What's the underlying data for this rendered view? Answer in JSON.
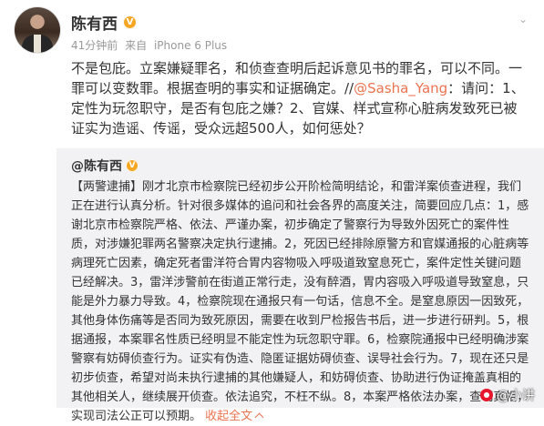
{
  "post": {
    "author": "陈有西",
    "verified_badge": "V",
    "time": "41分钟前",
    "source_prefix": "来自",
    "source": "iPhone 6 Plus",
    "text_part1": "不是包庇。立案嫌疑罪名，和侦查查明后起诉意见书的罪名，可以不同。一罪可以变数罪。根据查明的事实和证据确定。//",
    "mention": "@Sasha_Yang",
    "text_part2": "：请问：1、定性为玩忽职守，是否有包庇之嫌？2、官媒、样式宣称心脏病发致死已被证实为造谣、传谣，受众远超500人，如何惩处？"
  },
  "quoted": {
    "author": "@陈有西",
    "verified_badge": "V",
    "text": "【两警逮捕】刚才北京市检察院已经初步公开阶检简明结论，和雷洋案侦查进程，我们正在进行认真分析。针对很多媒体的追问和社会各界的高度关注，简要回应几点：1，感谢北京市检察院严格、依法、严谨办案，初步确定了警察行为导致外因死亡的案件性质，对涉嫌犯罪两名警察决定执行逮捕。2，死因已经排除原警方和官媒通报的心脏病等病理死亡因素，确定死者雷洋符合胃内容物吸入呼吸道致窒息死亡，案件定性关键问题已经解决。3，雷洋涉警前在街道正常行走，没有醉酒，胃内容吸入呼吸道导致窒息，只能是外力暴力导致。4，检察院现在通报只有一句话，信息不全。是窒息原因一因致死，其他身体伤痛等是否同为致死原因，需要在收到尸检报告书后，进一步进行研判。5，根据通报，本案罪名性质已经明显不能定性为玩忽职守罪。6，检察院通报中已经明确涉案警察有妨碍侦查行为。证实有伪造、隐匿证据妨碍侦查、误导社会行为。7，现在还只是初步侦查，希望对尚未执行逮捕的其他嫌疑人，和妨碍侦查、协助进行伪证掩盖真相的其他相关人，继续展开侦查。依法追究，不枉不纵。8，本案严格依法办案，查明真相，实现司法公正可以预期。",
    "expand_label": "收起全文",
    "expand_icon": "chevron-up-icon"
  },
  "watermark": {
    "text": "@小讲"
  }
}
